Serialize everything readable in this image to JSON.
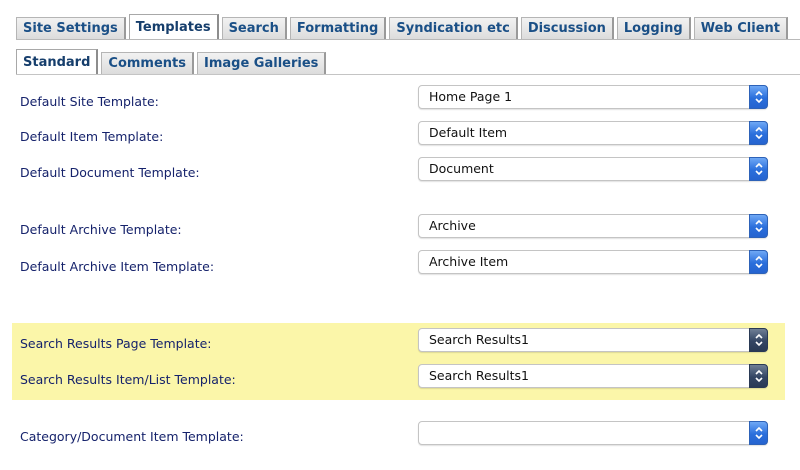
{
  "tabs": [
    {
      "label": "Site Settings",
      "active": false
    },
    {
      "label": "Templates",
      "active": true
    },
    {
      "label": "Search",
      "active": false
    },
    {
      "label": "Formatting",
      "active": false
    },
    {
      "label": "Syndication etc",
      "active": false
    },
    {
      "label": "Discussion",
      "active": false
    },
    {
      "label": "Logging",
      "active": false
    },
    {
      "label": "Web Client",
      "active": false
    }
  ],
  "subtabs": [
    {
      "label": "Standard",
      "active": true
    },
    {
      "label": "Comments",
      "active": false
    },
    {
      "label": "Image Galleries",
      "active": false
    }
  ],
  "fields": [
    {
      "label": "Default Site Template:",
      "value": "Home Page 1"
    },
    {
      "label": "Default Item Template:",
      "value": "Default Item"
    },
    {
      "label": "Default Document Template:",
      "value": "Document"
    },
    {
      "label": "Default Archive Template:",
      "value": "Archive"
    },
    {
      "label": "Default Archive Item Template:",
      "value": "Archive Item"
    },
    {
      "label": "Search Results Page Template:",
      "value": "Search Results1",
      "highlighted": true
    },
    {
      "label": "Search Results Item/List Template:",
      "value": "Search Results1",
      "highlighted": true
    },
    {
      "label": "Category/Document Item Template:",
      "value": ""
    }
  ],
  "colors": {
    "highlight": "#fbf6a9",
    "label": "#15226b",
    "tab_text": "#1a4f86",
    "stepper": "#2a6fdc"
  },
  "icons": {
    "select_arrows": "chevron-up-down-icon"
  }
}
